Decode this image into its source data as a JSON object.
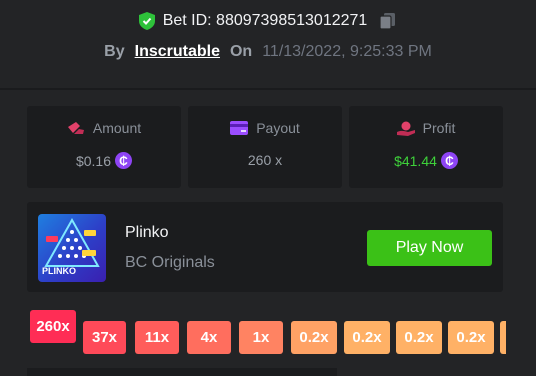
{
  "header": {
    "bet_id_label": "Bet ID: 88097398513012271",
    "by_label": "By",
    "username": "Inscrutable",
    "on_label": "On",
    "datetime": "11/13/2022, 9:25:33 PM"
  },
  "stats": {
    "amount": {
      "label": "Amount",
      "value": "$0.16"
    },
    "payout": {
      "label": "Payout",
      "value": "260 x"
    },
    "profit": {
      "label": "Profit",
      "value": "$41.44"
    },
    "coin_symbol": "₵"
  },
  "game": {
    "title": "Plinko",
    "subtitle": "BC Originals",
    "play_label": "Play Now",
    "thumb_label": "PLINKO"
  },
  "multipliers": [
    "260x",
    "37x",
    "11x",
    "4x",
    "1x",
    "0.2x",
    "0.2x",
    "0.2x",
    "0.2x"
  ],
  "colors": {
    "accent_green": "#3bc117",
    "coin_purple": "#8e44f5",
    "profit_green": "#3ed13a"
  }
}
